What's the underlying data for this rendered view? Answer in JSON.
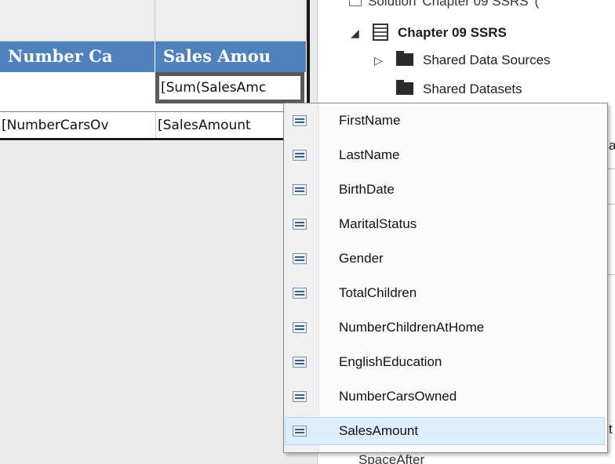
{
  "report": {
    "col1_header": "Number Ca",
    "col2_header": "Sales Amou",
    "sum_expression": "[Sum(SalesAmc",
    "row_expr_1": "[NumberCarsOv",
    "row_expr_2": "[SalesAmount"
  },
  "solution_explorer": {
    "solution_label": "Solution 'Chapter 09 SSRS' (",
    "project": "Chapter 09 SSRS",
    "items": [
      "Shared Data Sources",
      "Shared Datasets"
    ],
    "partial_right_1": "a",
    "partial_right_2": "t",
    "partial_bottom": "SpaceAfter"
  },
  "dropdown": {
    "items": [
      {
        "label": "FirstName",
        "icon": "field-icon"
      },
      {
        "label": "LastName",
        "icon": "field-icon"
      },
      {
        "label": "BirthDate",
        "icon": "field-icon"
      },
      {
        "label": "MaritalStatus",
        "icon": "field-icon"
      },
      {
        "label": "Gender",
        "icon": "field-icon"
      },
      {
        "label": "TotalChildren",
        "icon": "field-icon"
      },
      {
        "label": "NumberChildrenAtHome",
        "icon": "field-icon"
      },
      {
        "label": "EnglishEducation",
        "icon": "field-icon"
      },
      {
        "label": "NumberCarsOwned",
        "icon": "field-icon"
      },
      {
        "label": "SalesAmount",
        "icon": "field-icon"
      }
    ],
    "selected_index": 9
  },
  "colors": {
    "header_blue": "#4f81bd",
    "selection_bg": "#ddeefd"
  }
}
